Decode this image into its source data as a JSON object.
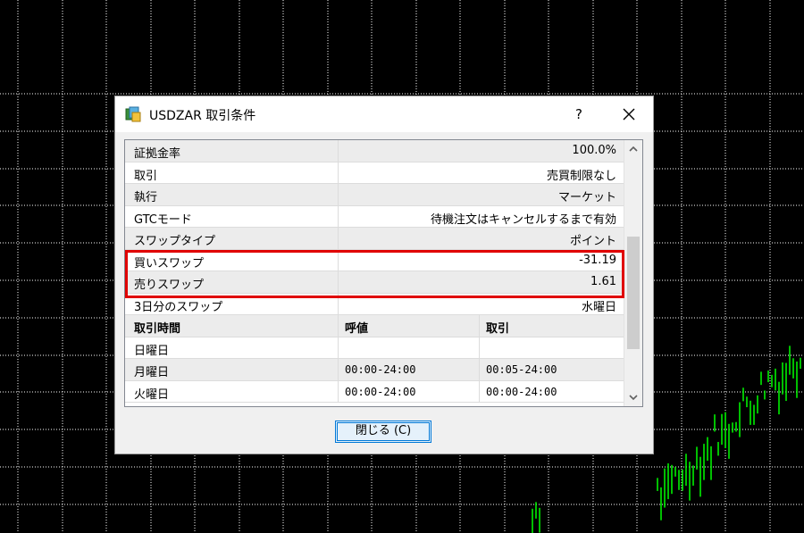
{
  "window": {
    "title": "USDZAR 取引条件",
    "help_label": "?",
    "close_icon": "close-icon",
    "app_icon": "symbol-properties-icon"
  },
  "properties": [
    {
      "name": "証拠金率",
      "value": "100.0%"
    },
    {
      "name": "取引",
      "value": "売買制限なし"
    },
    {
      "name": "執行",
      "value": "マーケット"
    },
    {
      "name": "GTCモード",
      "value": "待機注文はキャンセルするまで有効"
    },
    {
      "name": "スワップタイプ",
      "value": "ポイント"
    },
    {
      "name": "買いスワップ",
      "value": "-31.19"
    },
    {
      "name": "売りスワップ",
      "value": "1.61"
    },
    {
      "name": "3日分のスワップ",
      "value": "水曜日"
    }
  ],
  "sessions": {
    "headers": {
      "day": "取引時間",
      "quote": "呼値",
      "trade": "取引"
    },
    "rows": [
      {
        "day": "日曜日",
        "quote": "",
        "trade": ""
      },
      {
        "day": "月曜日",
        "quote": "00:00-24:00",
        "trade": "00:05-24:00"
      },
      {
        "day": "火曜日",
        "quote": "00:00-24:00",
        "trade": "00:00-24:00"
      }
    ]
  },
  "buttons": {
    "close_label": "閉じる (C)"
  },
  "colors": {
    "chart_background": "#000000",
    "chart_grid": "#ffffff",
    "candle": "#00ff00",
    "highlight": "#e00000",
    "button_accent": "#0078d7"
  }
}
